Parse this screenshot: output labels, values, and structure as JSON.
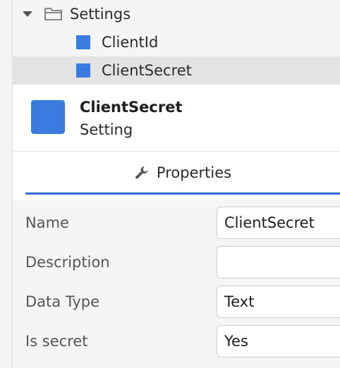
{
  "tree": {
    "folder_label": "Settings",
    "items": [
      {
        "label": "ClientId",
        "selected": false
      },
      {
        "label": "ClientSecret",
        "selected": true
      }
    ]
  },
  "header": {
    "title": "ClientSecret",
    "subtitle": "Setting"
  },
  "tabs": {
    "properties_label": "Properties"
  },
  "properties": {
    "name_label": "Name",
    "name_value": "ClientSecret",
    "description_label": "Description",
    "description_value": "",
    "data_type_label": "Data Type",
    "data_type_value": "Text",
    "is_secret_label": "Is secret",
    "is_secret_value": "Yes"
  },
  "colors": {
    "accent": "#3a7be0",
    "selected_row": "#e3e3e3"
  }
}
